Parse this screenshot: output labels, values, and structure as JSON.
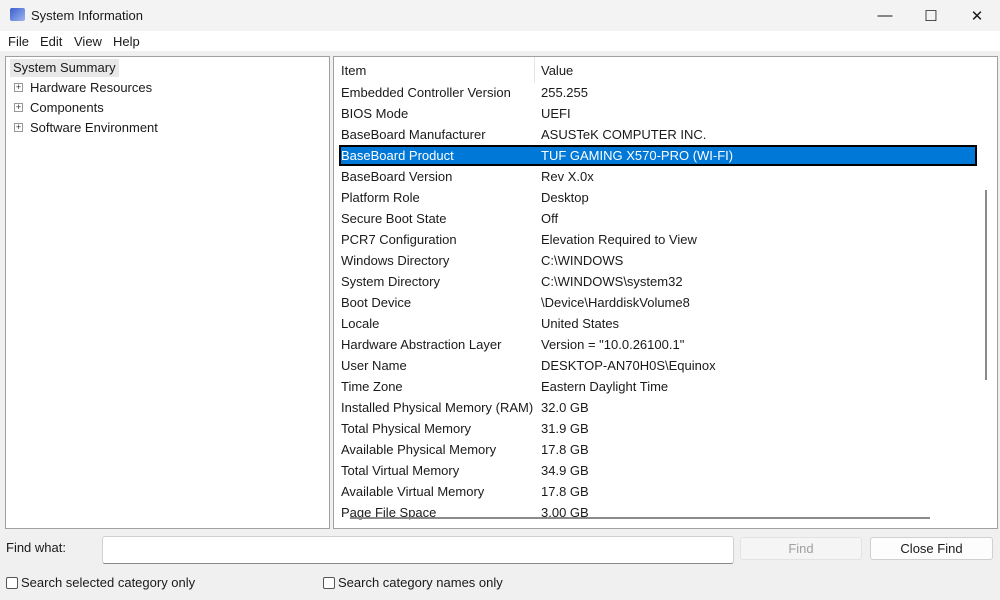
{
  "window": {
    "title": "System Information"
  },
  "menu": [
    "File",
    "Edit",
    "View",
    "Help"
  ],
  "tree": {
    "root": "System Summary",
    "children": [
      "Hardware Resources",
      "Components",
      "Software Environment"
    ]
  },
  "list": {
    "headers": {
      "item": "Item",
      "value": "Value"
    },
    "selected_index": 3,
    "rows": [
      {
        "item": "Embedded Controller Version",
        "value": "255.255"
      },
      {
        "item": "BIOS Mode",
        "value": "UEFI"
      },
      {
        "item": "BaseBoard Manufacturer",
        "value": "ASUSTeK COMPUTER INC."
      },
      {
        "item": "BaseBoard Product",
        "value": "TUF GAMING X570-PRO (WI-FI)"
      },
      {
        "item": "BaseBoard Version",
        "value": "Rev X.0x"
      },
      {
        "item": "Platform Role",
        "value": "Desktop"
      },
      {
        "item": "Secure Boot State",
        "value": "Off"
      },
      {
        "item": "PCR7 Configuration",
        "value": "Elevation Required to View"
      },
      {
        "item": "Windows Directory",
        "value": "C:\\WINDOWS"
      },
      {
        "item": "System Directory",
        "value": "C:\\WINDOWS\\system32"
      },
      {
        "item": "Boot Device",
        "value": "\\Device\\HarddiskVolume8"
      },
      {
        "item": "Locale",
        "value": "United States"
      },
      {
        "item": "Hardware Abstraction Layer",
        "value": "Version = \"10.0.26100.1\""
      },
      {
        "item": "User Name",
        "value": "DESKTOP-AN70H0S\\Equinox"
      },
      {
        "item": "Time Zone",
        "value": "Eastern Daylight Time"
      },
      {
        "item": "Installed Physical Memory (RAM)",
        "value": "32.0 GB"
      },
      {
        "item": "Total Physical Memory",
        "value": "31.9 GB"
      },
      {
        "item": "Available Physical Memory",
        "value": "17.8 GB"
      },
      {
        "item": "Total Virtual Memory",
        "value": "34.9 GB"
      },
      {
        "item": "Available Virtual Memory",
        "value": "17.8 GB"
      },
      {
        "item": "Page File Space",
        "value": "3.00 GB"
      }
    ]
  },
  "find": {
    "label": "Find what:",
    "value": "",
    "find_button": "Find",
    "close_button": "Close Find",
    "search_selected": "Search selected category only",
    "search_names": "Search category names only"
  }
}
